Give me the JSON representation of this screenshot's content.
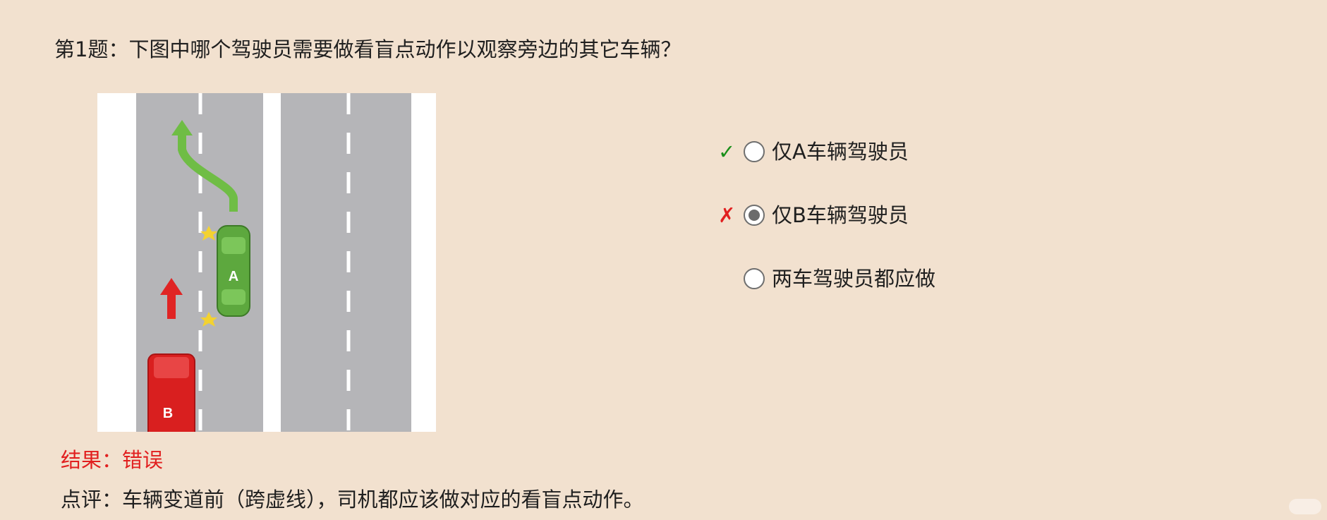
{
  "question": {
    "text": "第1题：下图中哪个驾驶员需要做看盲点动作以观察旁边的其它车辆？"
  },
  "figure": {
    "car_a_label": "A",
    "car_b_label": "B",
    "colors": {
      "road": "#b5b5b8",
      "lane_line": "#ffffff",
      "car_a": "#5da83e",
      "car_b": "#d91f1f",
      "arrow_green": "#6fbd45",
      "arrow_red": "#e02424",
      "blink": "#f3d230"
    }
  },
  "options": [
    {
      "label": "仅A车辆驾驶员",
      "checked": false,
      "mark": "✓",
      "mark_type": "correct"
    },
    {
      "label": "仅B车辆驾驶员",
      "checked": true,
      "mark": "✗",
      "mark_type": "wrong"
    },
    {
      "label": "两车驾驶员都应做",
      "checked": false,
      "mark": "",
      "mark_type": "none"
    }
  ],
  "result": {
    "text": "结果：错误",
    "color": "#e11f1f"
  },
  "comment": {
    "text": "点评：车辆变道前（跨虚线），司机都应该做对应的看盲点动作。"
  }
}
